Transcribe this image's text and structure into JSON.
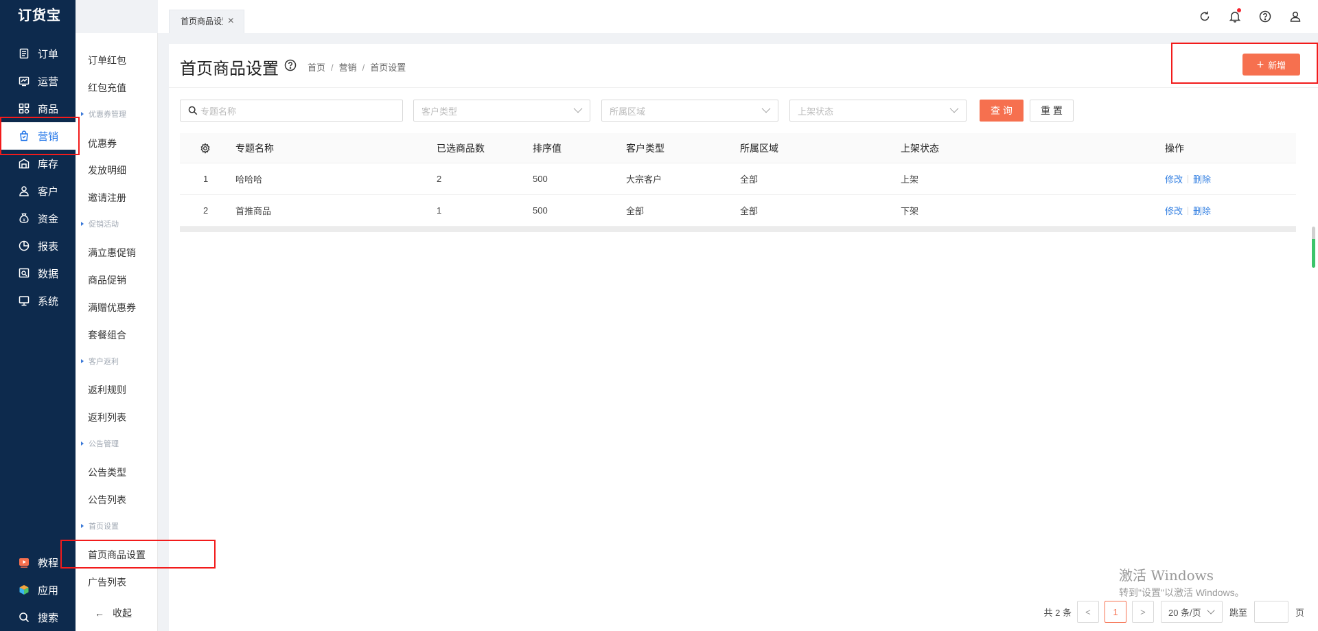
{
  "app": {
    "logo": "订货宝"
  },
  "nav": {
    "items": [
      {
        "label": "订单",
        "icon": "order-icon"
      },
      {
        "label": "运营",
        "icon": "operation-icon"
      },
      {
        "label": "商品",
        "icon": "product-icon"
      },
      {
        "label": "营销",
        "icon": "marketing-icon",
        "active": true
      },
      {
        "label": "库存",
        "icon": "warehouse-icon"
      },
      {
        "label": "客户",
        "icon": "customer-icon"
      },
      {
        "label": "资金",
        "icon": "money-icon"
      },
      {
        "label": "报表",
        "icon": "report-icon"
      },
      {
        "label": "数据",
        "icon": "data-icon"
      },
      {
        "label": "系统",
        "icon": "system-icon"
      }
    ],
    "bottom": [
      {
        "label": "教程",
        "icon": "tutorial-icon"
      },
      {
        "label": "应用",
        "icon": "apps-icon"
      },
      {
        "label": "搜索",
        "icon": "search-icon"
      }
    ]
  },
  "submenu": {
    "items": [
      "订单红包",
      "红包充值",
      "优惠券管理",
      "优惠券",
      "发放明细",
      "邀请注册",
      "促销活动",
      "满立惠促销",
      "商品促销",
      "满赠优惠券",
      "套餐组合",
      "客户返利",
      "返利规则",
      "返利列表",
      "公告管理",
      "公告类型",
      "公告列表",
      "首页设置",
      "首页商品设置",
      "广告列表"
    ],
    "collapse": "收起"
  },
  "tabs": [
    {
      "label": "首页商品设置"
    }
  ],
  "page": {
    "title": "首页商品设置",
    "breadcrumb": [
      "首页",
      "营销",
      "首页设置"
    ],
    "add_button": "新增"
  },
  "filters": {
    "name_placeholder": "专题名称",
    "customer_type_placeholder": "客户类型",
    "region_placeholder": "所属区域",
    "status_placeholder": "上架状态",
    "query_button": "查 询",
    "reset_button": "重 置"
  },
  "table": {
    "columns": [
      "专题名称",
      "已选商品数",
      "排序值",
      "客户类型",
      "所属区域",
      "上架状态",
      "操作"
    ],
    "rows": [
      {
        "no": "1",
        "name": "哈哈哈",
        "count": "2",
        "sort": "500",
        "customer_type": "大宗客户",
        "region": "全部",
        "status": "上架"
      },
      {
        "no": "2",
        "name": "首推商品",
        "count": "1",
        "sort": "500",
        "customer_type": "全部",
        "region": "全部",
        "status": "下架"
      }
    ],
    "edit_label": "修改",
    "delete_label": "删除"
  },
  "pagination": {
    "total": "共 2 条",
    "current_page": "1",
    "page_size": "20 条/页",
    "jump_label": "跳至",
    "page_unit": "页"
  },
  "watermark": {
    "line1": "激活 Windows",
    "line2": "转到\"设置\"以激活 Windows。"
  },
  "colors": {
    "nav_bg": "#0d2a4d",
    "accent": "#f6704f",
    "active_nav": "#1e73e8",
    "link": "#2f7de1",
    "highlight": "#f21b1b"
  }
}
